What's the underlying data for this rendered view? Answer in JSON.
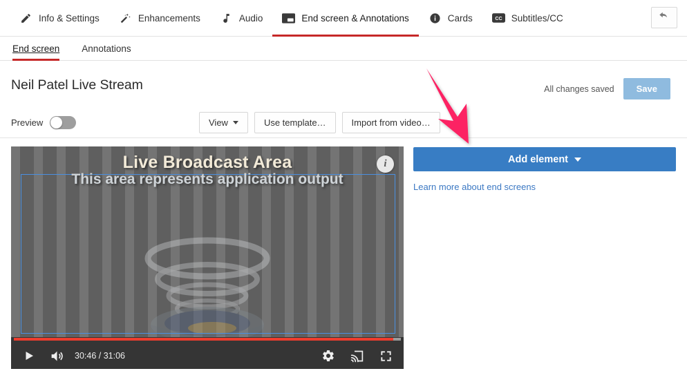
{
  "topnav": {
    "tabs": [
      {
        "label": "Info & Settings",
        "icon": "pencil-icon",
        "active": false
      },
      {
        "label": "Enhancements",
        "icon": "magic-wand-icon",
        "active": false
      },
      {
        "label": "Audio",
        "icon": "music-note-icon",
        "active": false
      },
      {
        "label": "End screen & Annotations",
        "icon": "end-screen-icon",
        "active": true
      },
      {
        "label": "Cards",
        "icon": "info-circle-icon",
        "active": false
      },
      {
        "label": "Subtitles/CC",
        "icon": "cc-icon",
        "active": false
      }
    ],
    "back_button_icon": "back-arrow-icon"
  },
  "subtabs": [
    {
      "label": "End screen",
      "active": true
    },
    {
      "label": "Annotations",
      "active": false
    }
  ],
  "header": {
    "title": "Neil Patel Live Stream",
    "saved_status": "All changes saved",
    "save_label": "Save"
  },
  "toolbar": {
    "preview_label": "Preview",
    "preview_on": false,
    "view_label": "View",
    "use_template_label": "Use template…",
    "import_label": "Import from video…"
  },
  "video": {
    "caption": "Live Broadcast Area",
    "selection_text": "This area represents application output",
    "info_icon": "info-circle-icon",
    "player": {
      "play_icon": "play-icon",
      "volume_icon": "volume-icon",
      "timecode": "30:46 / 31:06",
      "current_time": "30:46",
      "duration": "31:06",
      "progress_percent": 98,
      "settings_icon": "gear-icon",
      "cast_icon": "cast-icon",
      "fullscreen_icon": "fullscreen-icon"
    }
  },
  "right_panel": {
    "add_element_label": "Add element",
    "learn_more_label": "Learn more about end screens"
  },
  "annotation": {
    "arrow_color": "#FC2463",
    "arrow_icon": "down-right-arrow-annotation"
  },
  "colors": {
    "accent_blue": "#387DC4",
    "active_red": "#C62828",
    "save_disabled": "#8FBBDF",
    "link_blue": "#3B78C3",
    "progress_red": "#EF3D2E"
  }
}
